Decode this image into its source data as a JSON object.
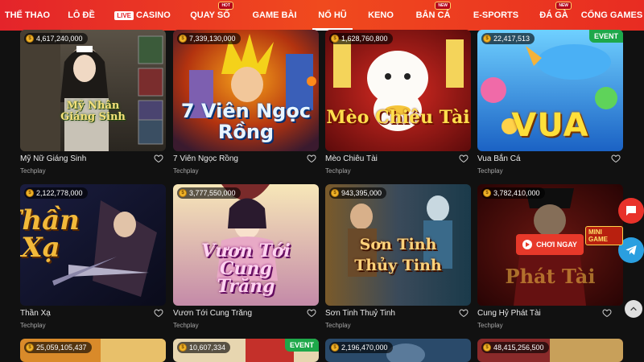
{
  "nav": {
    "items": [
      {
        "label": "THỂ THAO"
      },
      {
        "label": "LÔ ĐỀ"
      },
      {
        "label": "CASINO",
        "live": "LIVE"
      },
      {
        "label": "QUAY SỐ",
        "badge": "HOT"
      },
      {
        "label": "GAME BÀI"
      },
      {
        "label": "NỔ HŨ",
        "active": true
      },
      {
        "label": "KENO"
      },
      {
        "label": "BẮN CÁ",
        "badge": "NEW"
      },
      {
        "label": "E-SPORTS"
      },
      {
        "label": "ĐÁ GÀ",
        "badge": "NEW"
      },
      {
        "label": "CỔNG GAMES"
      }
    ]
  },
  "games": [
    {
      "title": "Mỹ Nữ Giáng Sinh",
      "provider": "Techplay",
      "jackpot": "4,617,240,000",
      "art": "Mỹ Nhân Giáng Sinh",
      "event": ""
    },
    {
      "title": "7 Viên Ngọc Rồng",
      "provider": "Techplay",
      "jackpot": "7,339,130,000",
      "art": "7 Viên Ngọc Rồng",
      "event": ""
    },
    {
      "title": "Mèo Chiêu Tài",
      "provider": "Techplay",
      "jackpot": "1,628,760,800",
      "art": "Mèo Chiêu Tài",
      "event": ""
    },
    {
      "title": "Vua Bắn Cá",
      "provider": "Techplay",
      "jackpot": "22,417,513",
      "art": "VUA",
      "event": "EVENT"
    },
    {
      "title": "Thần Xạ",
      "provider": "Techplay",
      "jackpot": "2,122,778,000",
      "art": "Thần Xạ",
      "event": ""
    },
    {
      "title": "Vươn Tới Cung Trăng",
      "provider": "Techplay",
      "jackpot": "3,777,550,000",
      "art": "Vươn Tới Cung Trăng",
      "event": ""
    },
    {
      "title": "Sơn Tinh Thuỷ Tinh",
      "provider": "Techplay",
      "jackpot": "943,395,000",
      "art": "Sơn Tinh Thủy Tinh",
      "event": ""
    },
    {
      "title": "Cung Hỷ Phát Tài",
      "provider": "Techplay",
      "jackpot": "3,782,410,000",
      "art": "Phát Tài",
      "event": "",
      "play_label": "CHƠI NGAY",
      "art_badge": "MINI GAME"
    },
    {
      "title": "",
      "provider": "",
      "jackpot": "25,059,105,437",
      "art": "",
      "event": ""
    },
    {
      "title": "",
      "provider": "",
      "jackpot": "10,607,334",
      "art": "",
      "event": "EVENT"
    },
    {
      "title": "",
      "provider": "",
      "jackpot": "2,196,470,000",
      "art": "",
      "event": ""
    },
    {
      "title": "",
      "provider": "",
      "jackpot": "48,415,256,500",
      "art": "",
      "event": ""
    }
  ],
  "icons": {
    "jackpot": "coin-icon",
    "favorite": "heart-icon",
    "chat": "chat-icon",
    "telegram": "telegram-icon",
    "top": "scroll-top-icon"
  },
  "colors": {
    "nav": "#e4242a",
    "background": "#111111",
    "event": "#1ea84a",
    "play": "#e7392a"
  }
}
